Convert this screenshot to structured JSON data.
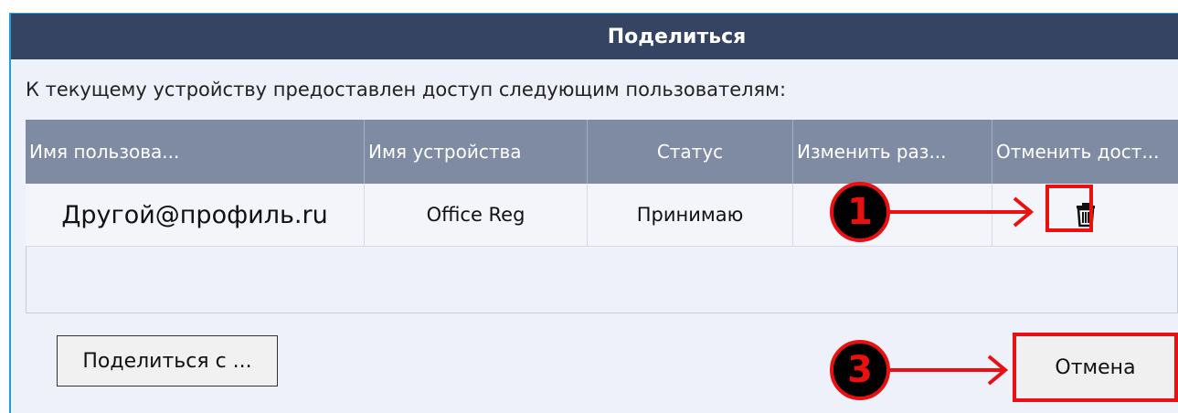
{
  "dialog": {
    "title": "Поделиться",
    "description": "К текущему устройству предоставлен доступ следующим пользователям:"
  },
  "table": {
    "headers": [
      "Имя пользова...",
      "Имя устройства",
      "Статус",
      "Изменить раз...",
      "Отменить дост..."
    ],
    "rows": [
      {
        "user": "Другой@профиль.ru",
        "device": "Office Reg",
        "status": "Принимаю",
        "change": "",
        "revoke_icon": "trash-icon"
      }
    ]
  },
  "buttons": {
    "share_with": "Поделиться с ...",
    "cancel": "Отмена"
  },
  "annotations": {
    "marker_1": "1",
    "marker_3": "3",
    "highlight_color": "#e81010"
  },
  "colors": {
    "titlebar": "#354463",
    "header": "#7f8ba3",
    "background": "#eef1f9"
  }
}
